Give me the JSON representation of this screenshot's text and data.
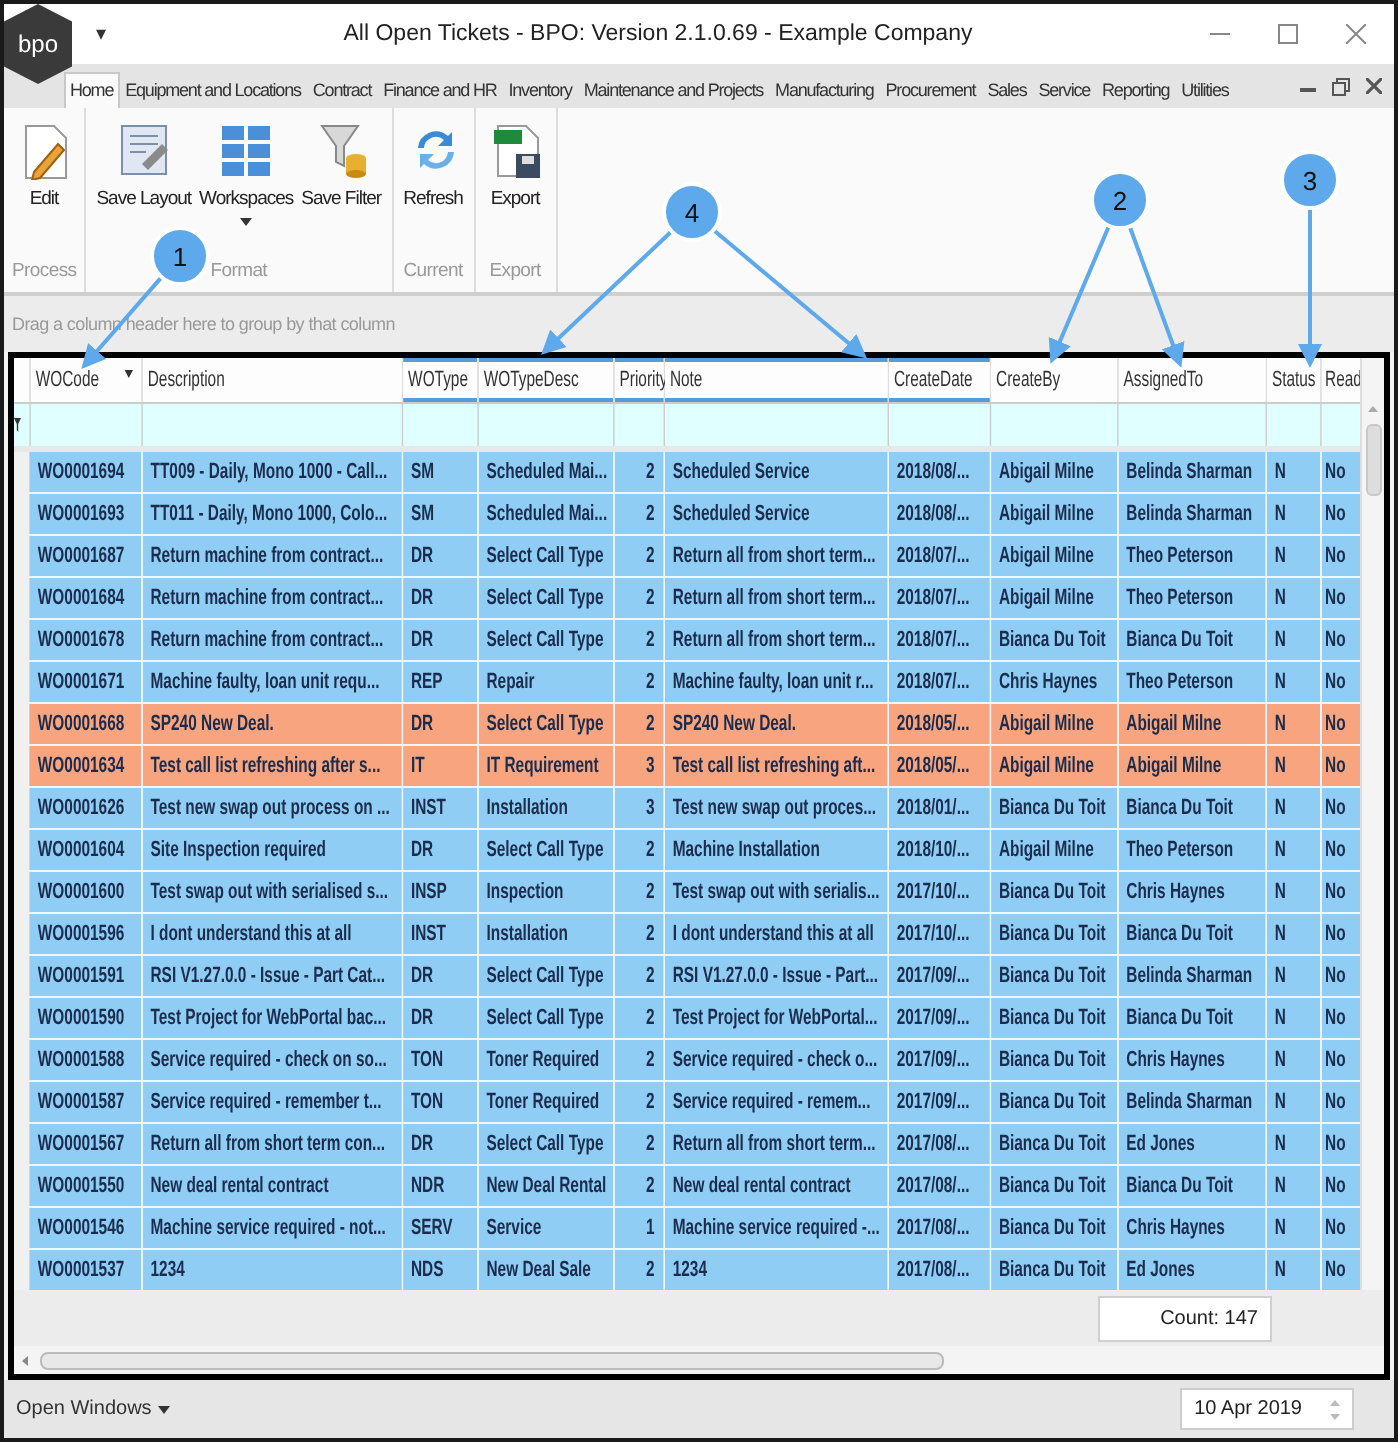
{
  "window": {
    "title": "All Open Tickets - BPO: Version 2.1.0.69 - Example Company",
    "logo_text": "bpo",
    "quick_access": "▾"
  },
  "tabs": [
    {
      "label": "Home",
      "selected": true
    },
    {
      "label": "Equipment and Locations",
      "selected": false
    },
    {
      "label": "Contract",
      "selected": false
    },
    {
      "label": "Finance and HR",
      "selected": false
    },
    {
      "label": "Inventory",
      "selected": false
    },
    {
      "label": "Maintenance and Projects",
      "selected": false
    },
    {
      "label": "Manufacturing",
      "selected": false
    },
    {
      "label": "Procurement",
      "selected": false
    },
    {
      "label": "Sales",
      "selected": false
    },
    {
      "label": "Service",
      "selected": false
    },
    {
      "label": "Reporting",
      "selected": false
    },
    {
      "label": "Utilities",
      "selected": false
    }
  ],
  "ribbon_groups": [
    {
      "label": "Process",
      "buttons": [
        {
          "label": "Edit",
          "kind": "edit",
          "dropdown": false
        }
      ]
    },
    {
      "label": "Format",
      "buttons": [
        {
          "label": "Save Layout",
          "kind": "layout",
          "dropdown": false
        },
        {
          "label": "Workspaces",
          "kind": "workspaces",
          "dropdown": true
        },
        {
          "label": "Save Filter",
          "kind": "filter",
          "dropdown": false
        }
      ]
    },
    {
      "label": "Current",
      "buttons": [
        {
          "label": "Refresh",
          "kind": "refresh",
          "dropdown": false
        }
      ]
    },
    {
      "label": "Export",
      "buttons": [
        {
          "label": "Export",
          "kind": "export",
          "dropdown": false
        }
      ]
    }
  ],
  "group_panel": {
    "hint": "Drag a column header here to group by that column"
  },
  "table": {
    "columns": [
      {
        "label": "WOCode",
        "sorted": true,
        "highlighted": false
      },
      {
        "label": "Description",
        "sorted": false,
        "highlighted": false
      },
      {
        "label": "WOType",
        "sorted": false,
        "highlighted": true
      },
      {
        "label": "WOTypeDesc",
        "sorted": false,
        "highlighted": true
      },
      {
        "label": "Priority",
        "sorted": false,
        "highlighted": true
      },
      {
        "label": "Note",
        "sorted": false,
        "highlighted": true
      },
      {
        "label": "CreateDate",
        "sorted": false,
        "highlighted": true
      },
      {
        "label": "CreateBy",
        "sorted": false,
        "highlighted": false
      },
      {
        "label": "AssignedTo",
        "sorted": false,
        "highlighted": false
      },
      {
        "label": "Status",
        "sorted": false,
        "highlighted": false
      },
      {
        "label": "Read",
        "sorted": false,
        "highlighted": false
      }
    ],
    "rows": [
      {
        "color": "#8fcdf5",
        "cells": [
          "WO0001694",
          "TT009 - Daily, Mono 1000 - Call...",
          "SM",
          "Scheduled Mai...",
          "2",
          "Scheduled Service",
          "2018/08/...",
          "Abigail Milne",
          "Belinda Sharman",
          "N",
          "No"
        ]
      },
      {
        "color": "#8fcdf5",
        "cells": [
          "WO0001693",
          "TT011 - Daily, Mono 1000, Colo...",
          "SM",
          "Scheduled Mai...",
          "2",
          "Scheduled Service",
          "2018/08/...",
          "Abigail Milne",
          "Belinda Sharman",
          "N",
          "No"
        ]
      },
      {
        "color": "#8fcdf5",
        "cells": [
          "WO0001687",
          "Return machine from contract...",
          "DR",
          "Select Call Type",
          "2",
          "Return all from short term...",
          "2018/07/...",
          "Abigail Milne",
          "Theo Peterson",
          "N",
          "No"
        ]
      },
      {
        "color": "#8fcdf5",
        "cells": [
          "WO0001684",
          "Return machine from contract...",
          "DR",
          "Select Call Type",
          "2",
          "Return all from short term...",
          "2018/07/...",
          "Abigail Milne",
          "Theo Peterson",
          "N",
          "No"
        ]
      },
      {
        "color": "#8fcdf5",
        "cells": [
          "WO0001678",
          "Return machine from contract...",
          "DR",
          "Select Call Type",
          "2",
          "Return all from short term...",
          "2018/07/...",
          "Bianca Du Toit",
          "Bianca Du Toit",
          "N",
          "No"
        ]
      },
      {
        "color": "#8fcdf5",
        "cells": [
          "WO0001671",
          "Machine faulty, loan unit requ...",
          "REP",
          "Repair",
          "2",
          "Machine faulty, loan unit r...",
          "2018/07/...",
          "Chris Haynes",
          "Theo Peterson",
          "N",
          "No"
        ]
      },
      {
        "color": "#f7a47f",
        "cells": [
          "WO0001668",
          "SP240 New Deal.",
          "DR",
          "Select Call Type",
          "2",
          "SP240 New Deal.",
          "2018/05/...",
          "Abigail Milne",
          "Abigail Milne",
          "N",
          "No"
        ]
      },
      {
        "color": "#f7a47f",
        "cells": [
          "WO0001634",
          "Test call list refreshing after s...",
          "IT",
          "IT Requirement",
          "3",
          "Test call list refreshing aft...",
          "2018/05/...",
          "Abigail Milne",
          "Abigail Milne",
          "N",
          "No"
        ]
      },
      {
        "color": "#8fcdf5",
        "cells": [
          "WO0001626",
          "Test new swap out process on ...",
          "INST",
          "Installation",
          "3",
          "Test new swap out proces...",
          "2018/01/...",
          "Bianca Du Toit",
          "Bianca Du Toit",
          "N",
          "No"
        ]
      },
      {
        "color": "#8fcdf5",
        "cells": [
          "WO0001604",
          "Site Inspection required",
          "DR",
          "Select Call Type",
          "2",
          "Machine Installation",
          "2018/10/...",
          "Abigail Milne",
          "Theo Peterson",
          "N",
          "No"
        ]
      },
      {
        "color": "#8fcdf5",
        "cells": [
          "WO0001600",
          "Test swap out with serialised s...",
          "INSP",
          "Inspection",
          "2",
          "Test swap out with serialis...",
          "2017/10/...",
          "Bianca Du Toit",
          "Chris Haynes",
          "N",
          "No"
        ]
      },
      {
        "color": "#8fcdf5",
        "cells": [
          "WO0001596",
          "I dont understand this at all",
          "INST",
          "Installation",
          "2",
          "I dont understand this at all",
          "2017/10/...",
          "Bianca Du Toit",
          "Bianca Du Toit",
          "N",
          "No"
        ]
      },
      {
        "color": "#8fcdf5",
        "cells": [
          "WO0001591",
          "RSI V1.27.0.0 - Issue - Part Cat...",
          "DR",
          "Select Call Type",
          "2",
          "RSI V1.27.0.0 - Issue - Part...",
          "2017/09/...",
          "Bianca Du Toit",
          "Belinda Sharman",
          "N",
          "No"
        ]
      },
      {
        "color": "#8fcdf5",
        "cells": [
          "WO0001590",
          "Test Project for WebPortal bac...",
          "DR",
          "Select Call Type",
          "2",
          "Test Project for WebPortal...",
          "2017/09/...",
          "Bianca Du Toit",
          "Bianca Du Toit",
          "N",
          "No"
        ]
      },
      {
        "color": "#8fcdf5",
        "cells": [
          "WO0001588",
          "Service required - check on so...",
          "TON",
          "Toner Required",
          "2",
          "Service required - check o...",
          "2017/09/...",
          "Bianca Du Toit",
          "Chris Haynes",
          "N",
          "No"
        ]
      },
      {
        "color": "#8fcdf5",
        "cells": [
          "WO0001587",
          "Service required - remember t...",
          "TON",
          "Toner Required",
          "2",
          "Service required - remem...",
          "2017/09/...",
          "Bianca Du Toit",
          "Belinda Sharman",
          "N",
          "No"
        ]
      },
      {
        "color": "#8fcdf5",
        "cells": [
          "WO0001567",
          "Return all from short term con...",
          "DR",
          "Select Call Type",
          "2",
          "Return all from short term...",
          "2017/08/...",
          "Bianca Du Toit",
          "Ed Jones",
          "N",
          "No"
        ]
      },
      {
        "color": "#8fcdf5",
        "cells": [
          "WO0001550",
          "New deal rental contract",
          "NDR",
          "New Deal Rental",
          "2",
          "New deal rental contract",
          "2017/08/...",
          "Bianca Du Toit",
          "Bianca Du Toit",
          "N",
          "No"
        ]
      },
      {
        "color": "#8fcdf5",
        "cells": [
          "WO0001546",
          "Machine service required - not...",
          "SERV",
          "Service",
          "1",
          "Machine service required -...",
          "2017/08/...",
          "Bianca Du Toit",
          "Chris Haynes",
          "N",
          "No"
        ]
      },
      {
        "color": "#8fcdf5",
        "cells": [
          "WO0001537",
          "1234",
          "NDS",
          "New Deal Sale",
          "2",
          "1234",
          "2017/08/...",
          "Bianca Du Toit",
          "Ed Jones",
          "N",
          "No"
        ]
      }
    ],
    "count": "Count: 147"
  },
  "status_bar": {
    "open_windows": "Open Windows",
    "date": "10 Apr 2019"
  },
  "annotations": [
    {
      "label": "1"
    },
    {
      "label": "4"
    },
    {
      "label": "2"
    },
    {
      "label": "3"
    }
  ]
}
